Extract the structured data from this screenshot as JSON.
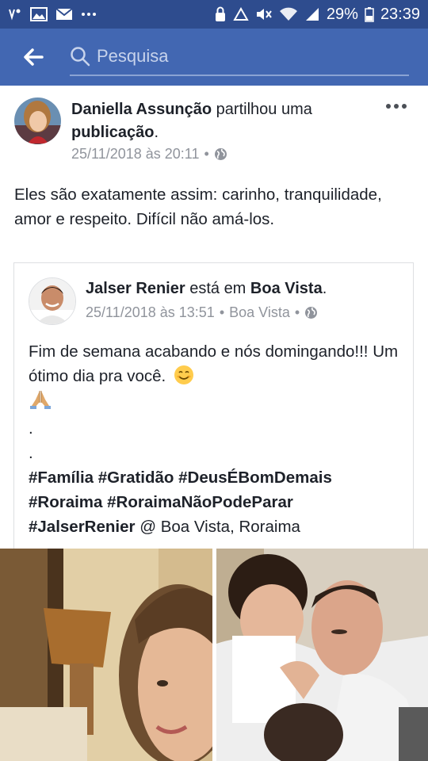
{
  "status": {
    "battery_percent": "29%",
    "time": "23:39"
  },
  "search": {
    "placeholder": "Pesquisa"
  },
  "post": {
    "author": "Daniella Assunção",
    "action": "partilhou uma",
    "object": "publicação",
    "date": "25/11/2018 às 20:11",
    "text": "Eles são exatamente assim: carinho, tranquilidade, amor e respeito. Difícil não amá-los."
  },
  "shared": {
    "author": "Jalser Renier",
    "verb": "está em",
    "place": "Boa Vista",
    "date": "25/11/2018 às 13:51",
    "location_meta": "Boa Vista",
    "line1": "Fim de semana acabando e nós domingando!!! Um ótimo dia pra você.",
    "dot": ".",
    "tags": [
      "#Família",
      "#Gratidão",
      "#DeusÉBomDemais",
      "#Roraima",
      "#RoraimaNãoPodeParar",
      "#JalserRenier"
    ],
    "tag_suffix": "@ Boa Vista, Roraima"
  },
  "colors": {
    "header": "#4267b2",
    "statusbar": "#2e4c8e",
    "meta_grey": "#90949c"
  },
  "icons": [
    "back-arrow-icon",
    "search-icon",
    "more-dots-icon",
    "globe-icon",
    "smile-emoji-icon",
    "pray-emoji-icon"
  ]
}
